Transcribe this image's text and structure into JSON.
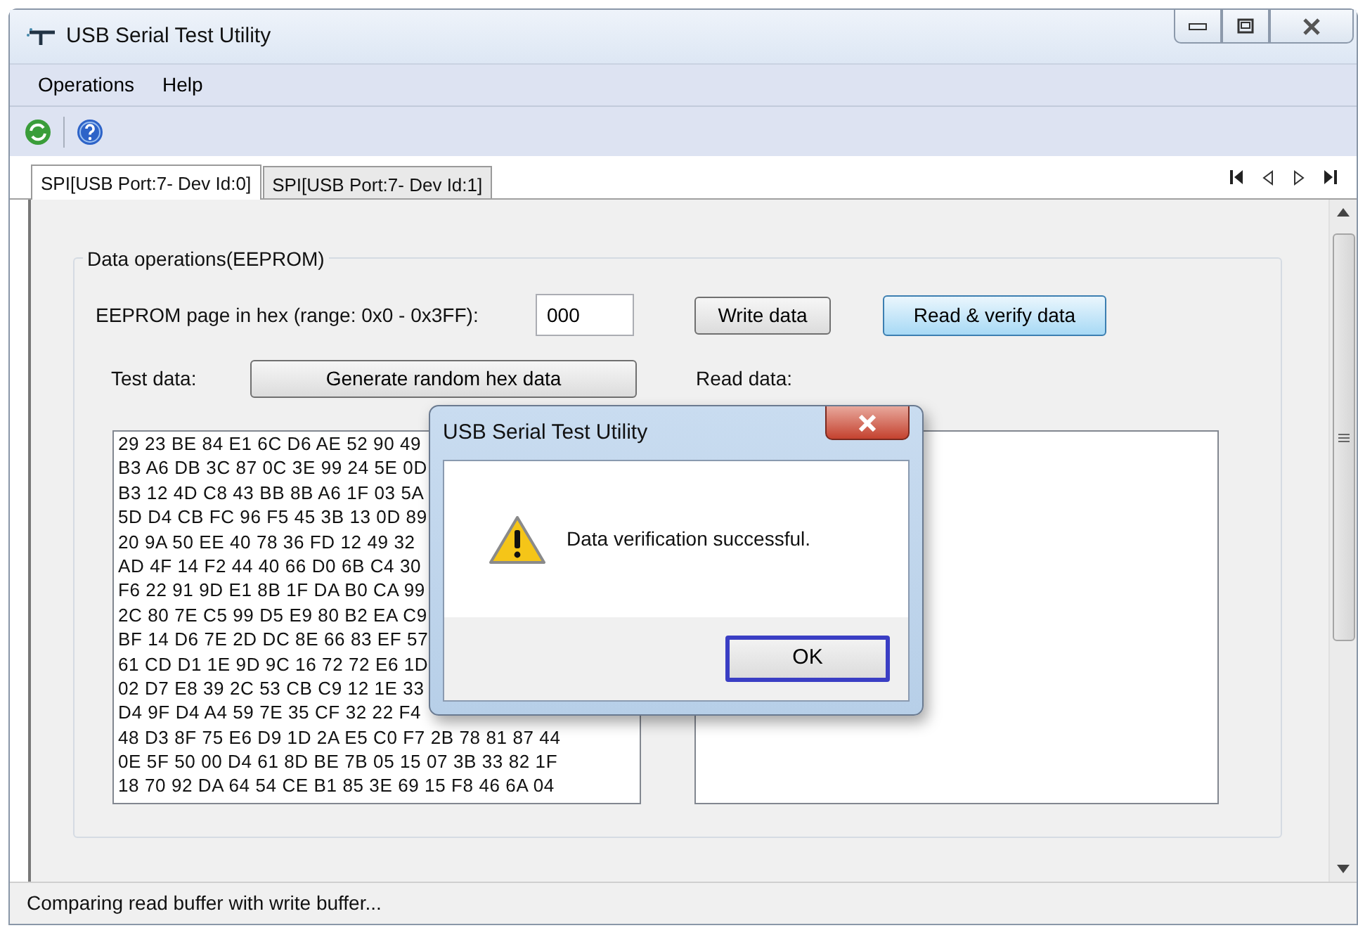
{
  "window": {
    "title": "USB Serial Test Utility"
  },
  "menu": [
    "Operations",
    "Help"
  ],
  "tabs": [
    {
      "label": "SPI[USB Port:7- Dev Id:0]",
      "selected": true
    },
    {
      "label": "SPI[USB Port:7- Dev Id:1]",
      "selected": false
    }
  ],
  "group": {
    "title": "Data operations(EEPROM)",
    "page_label": "EEPROM page in hex (range: 0x0 - 0x3FF):",
    "page_value": "000",
    "buttons": [
      {
        "label": "Write data",
        "highlighted": false
      },
      {
        "label": "Read & verify data",
        "highlighted": true
      }
    ],
    "test_data_label": "Test data:",
    "generate_button": "Generate random hex data",
    "read_data_label": "Read data:",
    "test_data_lines": [
      "29 23 BE 84 E1 6C D6 AE 52 90 49",
      "B3 A6 DB 3C 87 0C 3E 99 24 5E 0D",
      "B3 12 4D C8 43 BB 8B A6 1F 03 5A",
      "5D D4 CB FC 96 F5 45 3B 13 0D 89",
      "20 9A 50 EE 40 78 36 FD 12 49 32",
      "AD 4F 14 F2 44 40 66 D0 6B C4 30",
      "F6 22 91 9D E1 8B 1F DA B0 CA 99",
      "2C 80 7E C5 99 D5 E9 80 B2 EA C9",
      "BF 14 D6 7E 2D DC 8E 66 83 EF 57",
      "61 CD D1 1E 9D 9C 16 72 72 E6 1D",
      "02 D7 E8 39 2C 53 CB C9 12 1E 33",
      "D4 9F D4 A4 59 7E 35 CF 32 22 F4",
      "48 D3 8F 75 E6 D9 1D 2A E5 C0 F7 2B 78 81 87 44",
      "0E 5F 50 00 D4 61 8D BE 7B 05 15 07 3B 33 82 1F",
      "18 70 92 DA 64 54 CE B1 85 3E 69 15 F8 46 6A 04"
    ]
  },
  "dialog": {
    "title": "USB Serial Test Utility",
    "message": "Data verification successful.",
    "button": "OK",
    "button_focused": true
  },
  "status_bar": "Comparing read buffer with write buffer..."
}
